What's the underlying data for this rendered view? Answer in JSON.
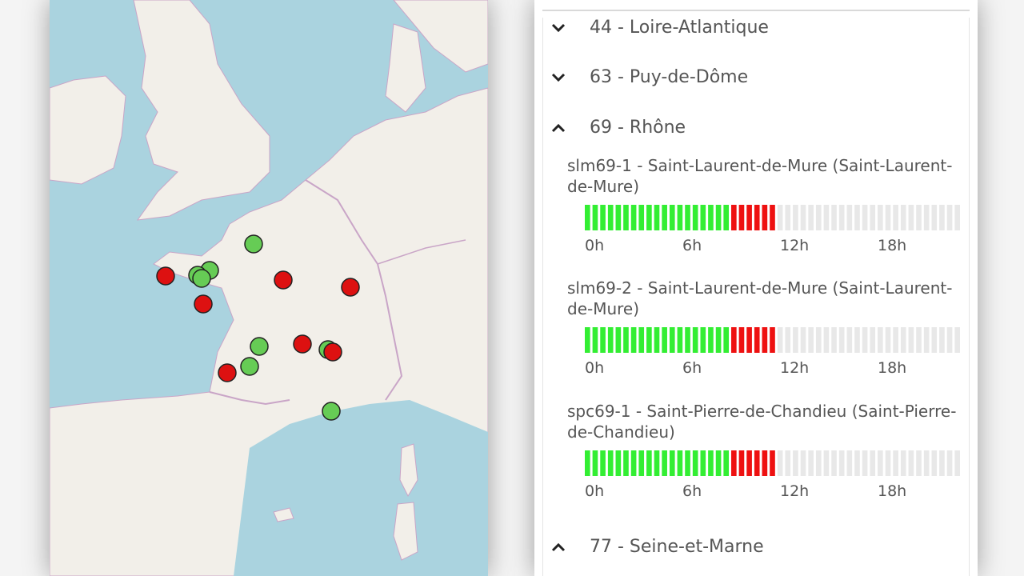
{
  "map": {
    "markers": [
      {
        "color": "green"
      },
      {
        "color": "red"
      },
      {
        "color": "green"
      },
      {
        "color": "green"
      },
      {
        "color": "green"
      },
      {
        "color": "red"
      },
      {
        "color": "red"
      },
      {
        "color": "red"
      },
      {
        "color": "green"
      },
      {
        "color": "red"
      },
      {
        "color": "green"
      },
      {
        "color": "red"
      },
      {
        "color": "green"
      },
      {
        "color": "red"
      },
      {
        "color": "green"
      }
    ],
    "colors": {
      "sea": "#aad3df",
      "land": "#f2efe9",
      "border": "#c9a5c7",
      "green": "#66cc55",
      "red": "#dd1111"
    }
  },
  "list": {
    "departments": [
      {
        "label": "44 - Loire-Atlantique",
        "expanded": false
      },
      {
        "label": "63 - Puy-de-Dôme",
        "expanded": false
      },
      {
        "label": "69 - Rhône",
        "expanded": true
      },
      {
        "label": "77 - Seine-et-Marne",
        "expanded": true
      }
    ],
    "stations": [
      {
        "title": "slm69-1 - Saint-Laurent-de-Mure (Saint-Laurent-de-Mure)",
        "green_segments": 19,
        "red_segments": 6,
        "total_segments": 49
      },
      {
        "title": "slm69-2 - Saint-Laurent-de-Mure (Saint-Laurent-de-Mure)",
        "green_segments": 19,
        "red_segments": 6,
        "total_segments": 49
      },
      {
        "title": "spc69-1 - Saint-Pierre-de-Chandieu (Saint-Pierre-de-Chandieu)",
        "green_segments": 19,
        "red_segments": 6,
        "total_segments": 49
      }
    ],
    "time_ticks": [
      "0h",
      "6h",
      "12h",
      "18h"
    ],
    "colors": {
      "green": "#33ee33",
      "red": "#ee1111",
      "empty": "#e8e8e8"
    }
  }
}
